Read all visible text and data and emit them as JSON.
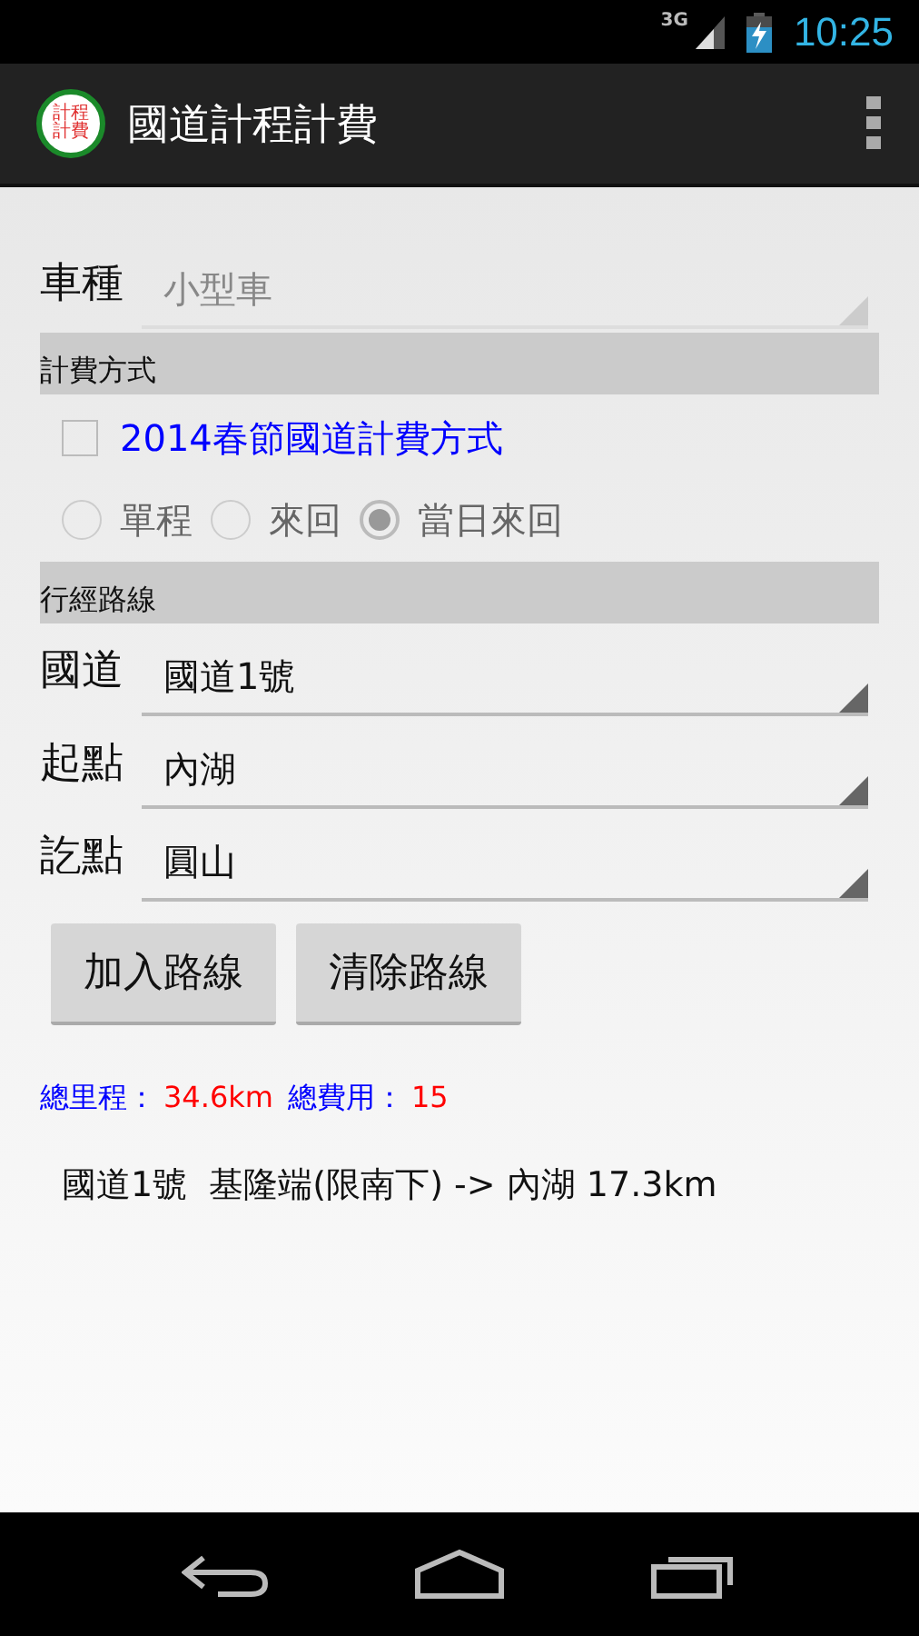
{
  "status_bar": {
    "network": "3G",
    "time": "10:25"
  },
  "action_bar": {
    "logo": {
      "lines": [
        "計程",
        "計費"
      ]
    },
    "title": "國道計程計費"
  },
  "vehicle": {
    "label": "車種",
    "value": "小型車",
    "disabled": true
  },
  "billing_section": {
    "title": "計費方式"
  },
  "holiday_option": {
    "label": "2014春節國道計費方式",
    "checked": false
  },
  "trip_options": [
    {
      "label": "單程",
      "selected": false
    },
    {
      "label": "來回",
      "selected": false
    },
    {
      "label": "當日來回",
      "selected": true
    }
  ],
  "route_section": {
    "title": "行經路線"
  },
  "route_fields": [
    {
      "label": "國道",
      "value": "國道1號"
    },
    {
      "label": "起點",
      "value": "內湖"
    },
    {
      "label": "訖點",
      "value": "圓山"
    }
  ],
  "buttons": [
    "加入路線",
    "清除路線"
  ],
  "summary": [
    {
      "kind": "label",
      "text": "總里程："
    },
    {
      "kind": "value",
      "text": "34.6km"
    },
    {
      "kind": "label",
      "text": "總費用："
    },
    {
      "kind": "value",
      "text": "15"
    }
  ],
  "routes": [
    "國道1號  基隆端(限南下) -> 內湖 17.3km"
  ]
}
